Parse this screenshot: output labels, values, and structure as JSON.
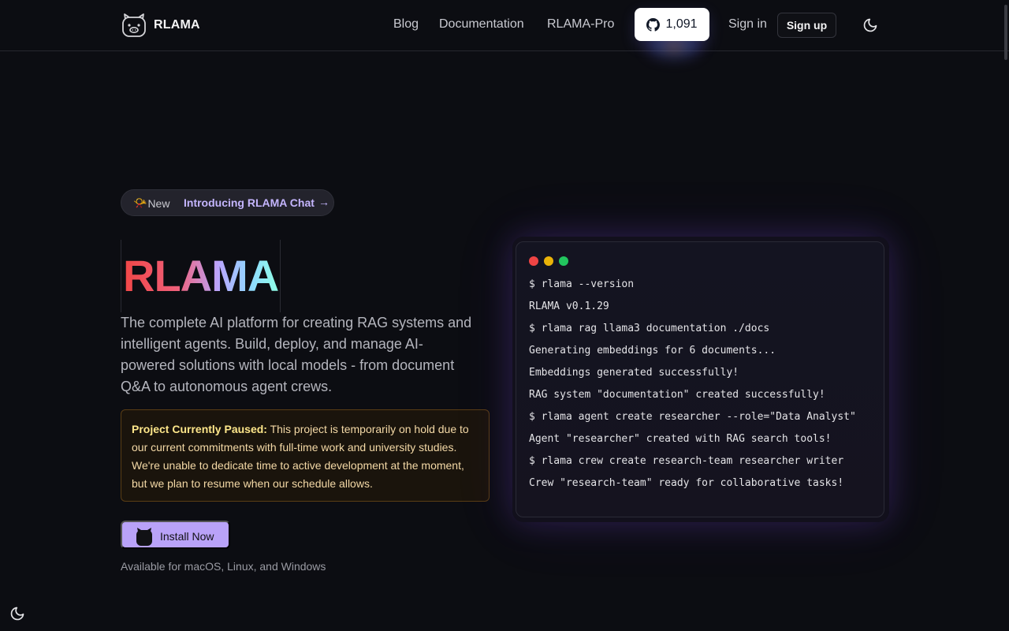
{
  "header": {
    "logo_text": "RLAMA",
    "nav": [
      {
        "label": "Blog"
      },
      {
        "label": "Documentation"
      },
      {
        "label": "RLAMA-Pro"
      }
    ],
    "github_stars": "1,091",
    "sign_in": "Sign in",
    "sign_up": "Sign up"
  },
  "badge": {
    "new_label": "New",
    "text": "Introducing RLAMA Chat",
    "arrow": "→"
  },
  "hero": {
    "title": "RLAMA",
    "description": "The complete AI platform for creating RAG systems and intelligent agents. Build, deploy, and manage AI-powered solutions with local models - from document Q&A to autonomous agent crews."
  },
  "notice": {
    "heading": "Project Currently Paused:",
    "body": " This project is temporarily on hold due to our current commitments with full-time work and university studies. We're unable to dedicate time to active development at the moment, but we plan to resume when our schedule allows."
  },
  "install": {
    "label": "Install Now",
    "availability": "Available for macOS, Linux, and Windows"
  },
  "terminal": {
    "lines": [
      "$ rlama --version",
      "RLAMA v0.1.29",
      "$ rlama rag llama3 documentation ./docs",
      "Generating embeddings for 6 documents...",
      "Embeddings generated successfully!",
      "RAG system \"documentation\" created successfully!",
      "$ rlama agent create researcher --role=\"Data Analyst\"",
      "Agent \"researcher\" created with RAG search tools!",
      "$ rlama crew create research-team researcher writer",
      "Crew \"research-team\" ready for collaborative tasks!"
    ]
  },
  "icons": {
    "logo": "llama-face-icon",
    "github": "github-icon",
    "theme": "moon-icon",
    "badge": "megaphone-icon",
    "install": "llama-head-icon"
  },
  "colors": {
    "background": "#0c0d12",
    "accent": "#b9a2f8",
    "badge_text": "#c4b5fd",
    "notice_border": "#5a3d14"
  }
}
